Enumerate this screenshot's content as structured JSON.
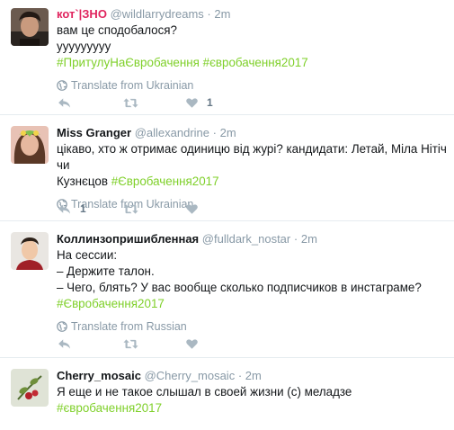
{
  "tweets": [
    {
      "name": "кот`|ЗНО",
      "name_color": "#e0245e",
      "handle": "@wildlarrydreams",
      "time": "2m",
      "lines": [
        "вам це сподобалося?",
        "ууууууууу"
      ],
      "hashtag_line": "#ПритулуНаЄвробачення #євробачення2017",
      "translate": "Translate from Ukrainian",
      "reply_count": "",
      "retweet_count": "",
      "like_count": "1"
    },
    {
      "name": "Miss Granger",
      "handle": "@allexandrine",
      "time": "2m",
      "line1": "цікаво, хто ж отримає одиницю від журі? кандидати: Летай, Міла Нітіч чи",
      "line2_text": "Кузнєцов",
      "line2_hashtag": "#Євробачення2017",
      "translate": "Translate from Ukrainian",
      "reply_count": "1",
      "retweet_count": "",
      "like_count": ""
    },
    {
      "name": "Коллинзопришибленная",
      "handle": "@fulldark_nostar",
      "time": "2m",
      "lines": [
        "На сессии:",
        "– Держите талон.",
        "– Чего, блять? У вас вообще сколько подписчиков в инстаграме?"
      ],
      "hashtag_line": "#Євробачення2017",
      "translate": "Translate from Russian",
      "reply_count": "",
      "retweet_count": "",
      "like_count": ""
    },
    {
      "name": "Cherry_mosaic",
      "handle": "@Cherry_mosaic",
      "time": "2m",
      "lines": [
        "Я еще и не такое слышал в своей жизни (с) меладзе"
      ],
      "hashtag_line": "#євробачення2017"
    }
  ],
  "separator": "·",
  "colors": {
    "hashtag": "#7fd02a",
    "muted": "#8899a6",
    "icon": "#aab8c2"
  },
  "icons": [
    "reply-icon",
    "retweet-icon",
    "like-icon",
    "globe-icon"
  ]
}
